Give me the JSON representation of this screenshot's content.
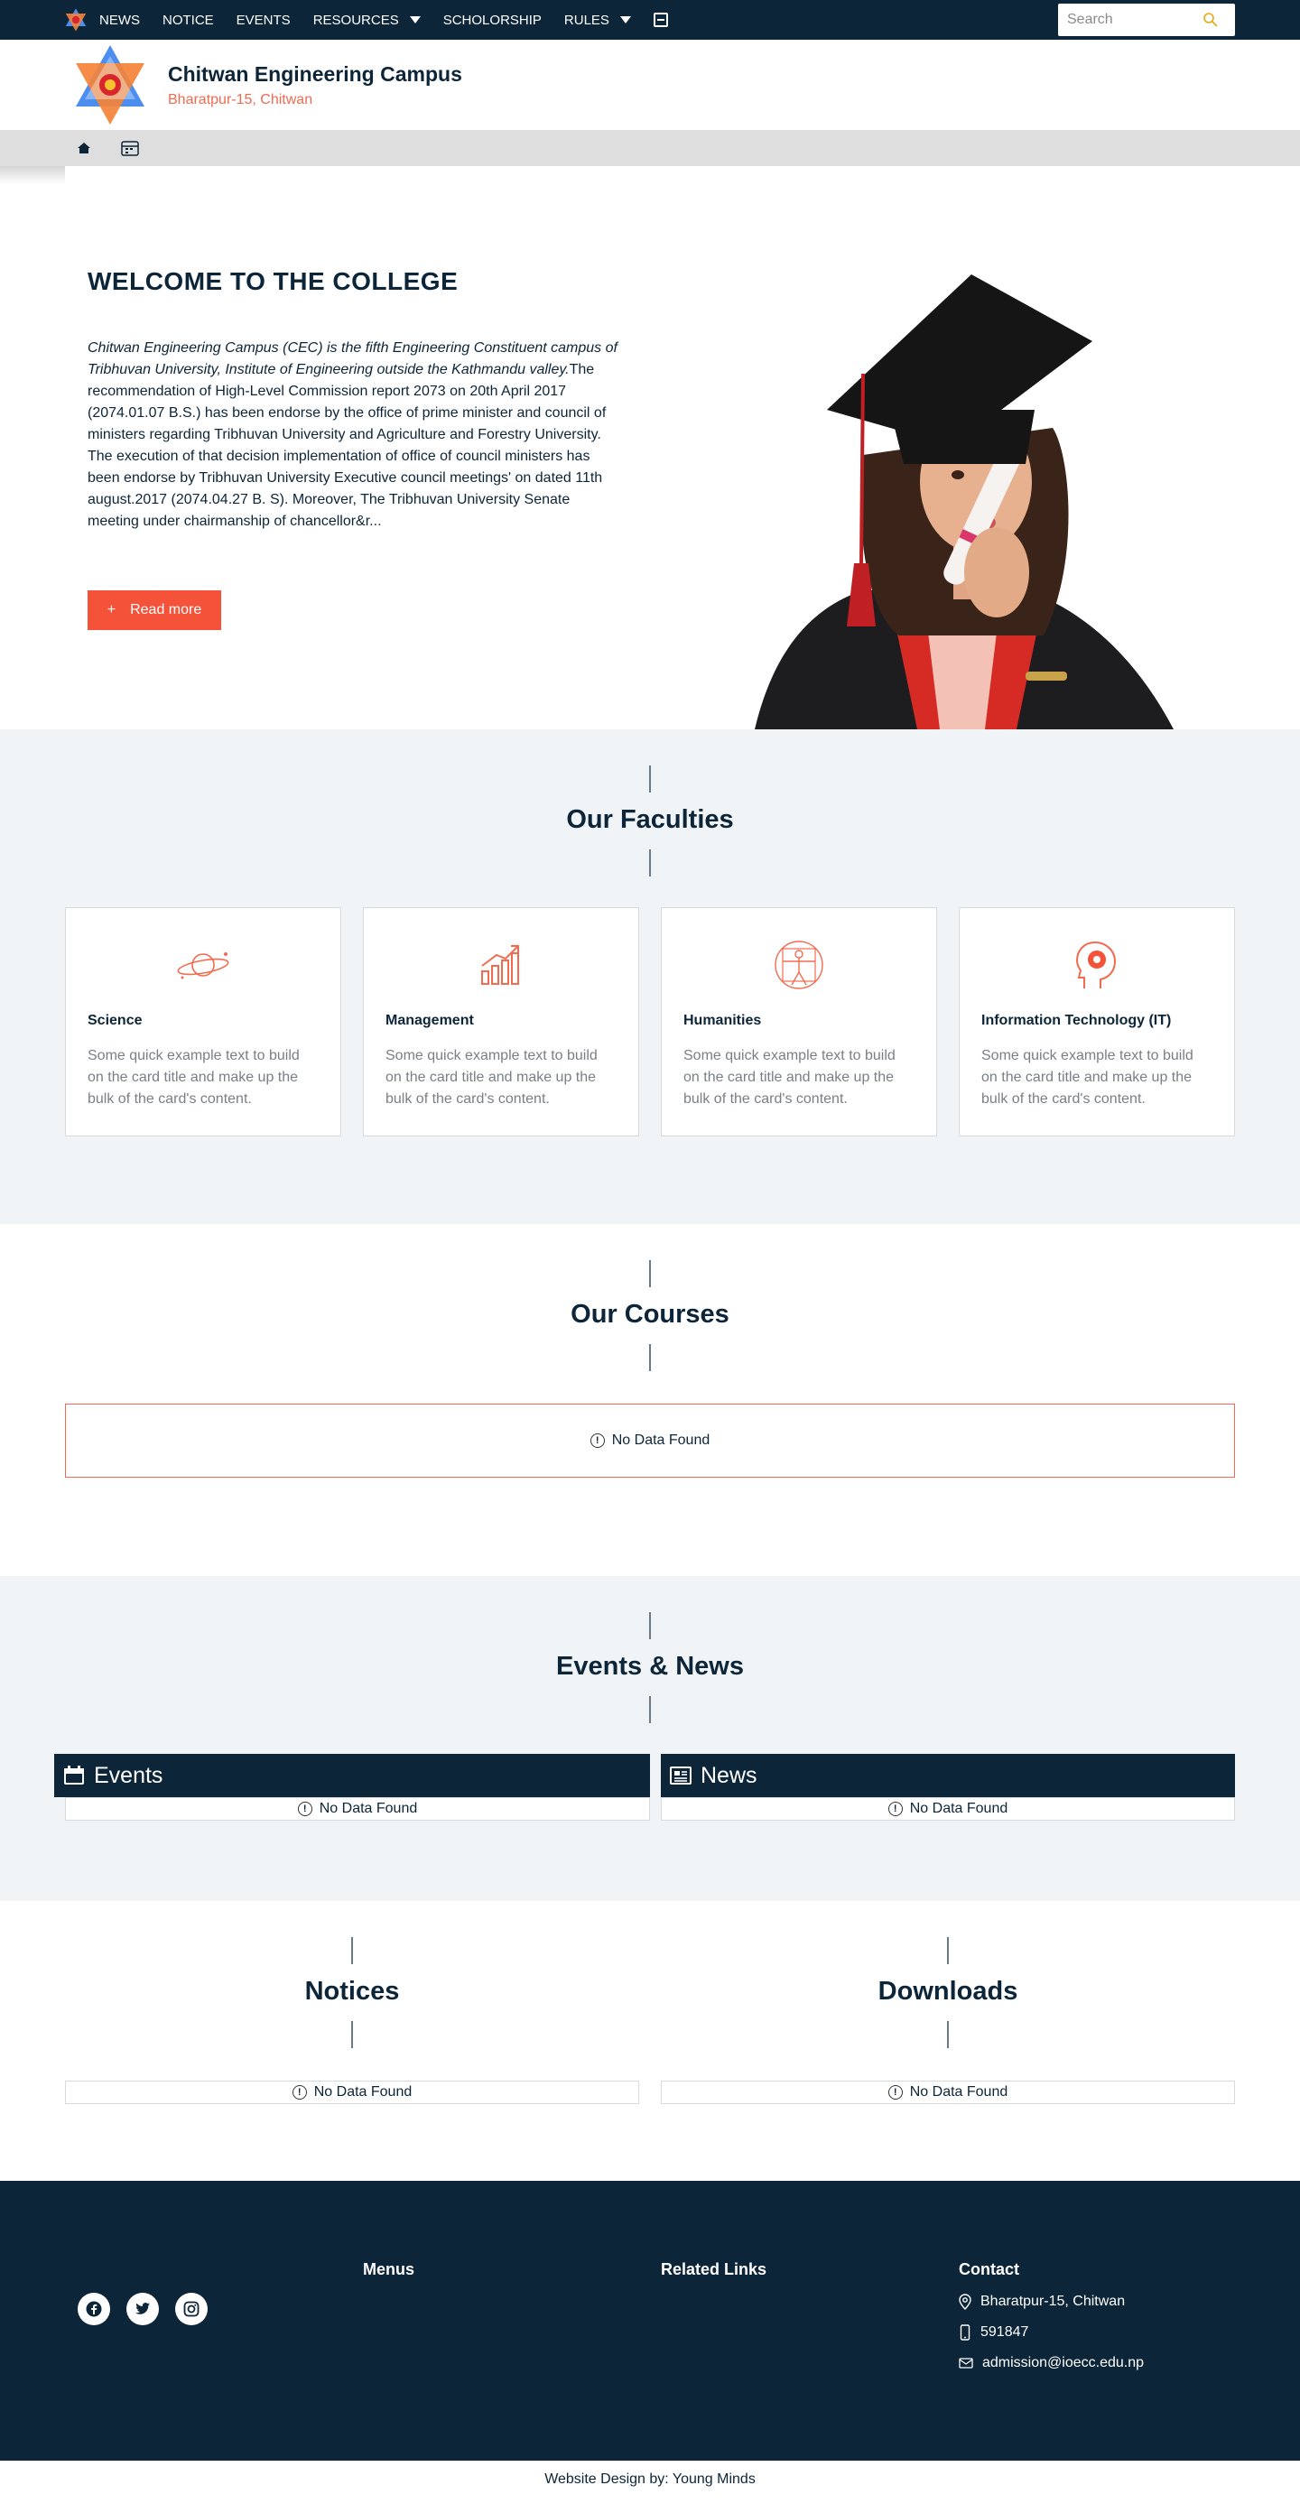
{
  "nav": {
    "items": [
      "NEWS",
      "NOTICE",
      "EVENTS",
      "RESOURCES",
      "SCHOLORSHIP",
      "RULES"
    ],
    "search_placeholder": "Search"
  },
  "header": {
    "title": "Chitwan Engineering Campus",
    "subtitle": "Bharatpur-15, Chitwan"
  },
  "hero": {
    "heading": "WELCOME TO THE COLLEGE",
    "intro_italic": "Chitwan Engineering Campus (CEC) is the fifth Engineering Constituent campus of Tribhuvan University, Institute of Engineering  outside the Kathmandu valley.",
    "intro_rest": "The recommendation of High-Level Commission report 2073 on 20th April 2017 (2074.01.07 B.S.) has been endorse by the office of prime minister and council of ministers regarding Tribhuvan University and Agriculture and Forestry University. The execution of that decision implementation of office of council ministers has been endorse by Tribhuvan University Executive council meetings' on dated 11th august.2017 (2074.04.27 B. S). Moreover, The Tribhuvan University Senate meeting under chairmanship of chancellor&r...",
    "button_icon": "+",
    "button_label": "Read more"
  },
  "faculties": {
    "title": "Our Faculties",
    "cards": [
      {
        "icon": "planet-icon",
        "title": "Science",
        "text": "Some quick example text to build on the card title and make up the bulk of the card's content."
      },
      {
        "icon": "growth-chart-icon",
        "title": "Management",
        "text": "Some quick example text to build on the card title and make up the bulk of the card's content."
      },
      {
        "icon": "vitruvian-man-icon",
        "title": "Humanities",
        "text": "Some quick example text to build on the card title and make up the bulk of the card's content."
      },
      {
        "icon": "brain-head-icon",
        "title": "Information Technology (IT)",
        "text": "Some quick example text to build on the card title and make up the bulk of the card's content."
      }
    ]
  },
  "courses": {
    "title": "Our Courses",
    "empty": "No Data Found"
  },
  "events_news": {
    "title": "Events & News",
    "events_label": "Events",
    "news_label": "News",
    "events_empty": "No Data Found",
    "news_empty": "No Data Found"
  },
  "notices": {
    "title": "Notices",
    "empty": "No Data Found"
  },
  "downloads": {
    "title": "Downloads",
    "empty": "No Data Found"
  },
  "footer": {
    "menus": "Menus",
    "related": "Related Links",
    "contact": "Contact",
    "address": "Bharatpur-15, Chitwan",
    "phone": "591847",
    "email": "admission@ioecc.edu.np",
    "social": [
      "facebook-icon",
      "twitter-icon",
      "instagram-icon"
    ]
  },
  "credit": "Website Design by: Young Minds",
  "colors": {
    "navy": "#0d2538",
    "accent": "#f4533a",
    "bg_light": "#f1f4f6"
  }
}
